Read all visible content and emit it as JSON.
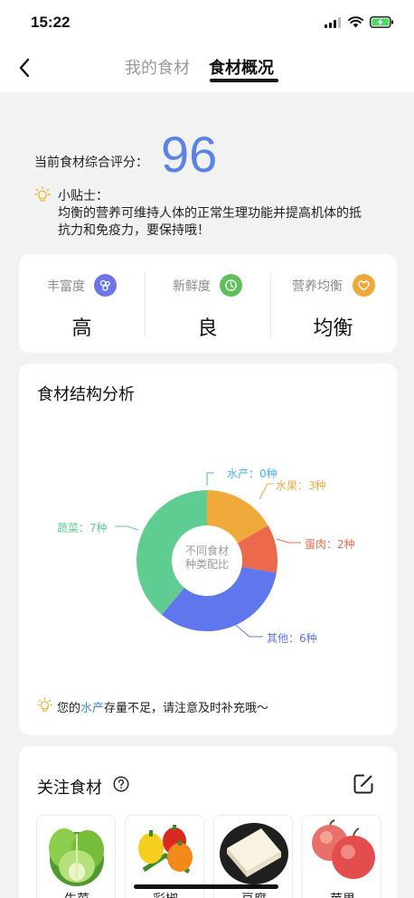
{
  "status_bar": {
    "time": "15:22"
  },
  "nav": {
    "tabs": [
      {
        "label": "我的食材",
        "active": false
      },
      {
        "label": "食材概况",
        "active": true
      }
    ]
  },
  "score": {
    "label": "当前食材综合评分：",
    "value": "96",
    "tip_title": "小贴士：",
    "tip_text": "均衡的营养可维持人体的正常生理功能并提高机体的抵抗力和免疫力，要保持哦！"
  },
  "metrics": [
    {
      "label": "丰富度",
      "value": "高",
      "icon": "richness-icon",
      "color": "#6e75e6"
    },
    {
      "label": "新鲜度",
      "value": "良",
      "icon": "clock-icon",
      "color": "#5cc15b"
    },
    {
      "label": "营养均衡",
      "value": "均衡",
      "icon": "balance-icon",
      "color": "#f2a93b"
    }
  ],
  "analysis": {
    "title": "食材结构分析",
    "center_line1": "不同食材",
    "center_line2": "种类配比",
    "labels": {
      "aquatic": "水产：0种",
      "fruit": "水果：3种",
      "meat": "蛋肉：2种",
      "other": "其他：6种",
      "veg": "蔬菜：7种"
    },
    "notice_prefix": "您的",
    "notice_highlight": "水产",
    "notice_suffix": "存量不足，请注意及时补充哦～"
  },
  "chart_data": {
    "type": "pie",
    "title": "",
    "donut": true,
    "series": [
      {
        "name": "水产",
        "value": 0,
        "color": "#45b4e0"
      },
      {
        "name": "水果",
        "value": 3,
        "color": "#f0a93b"
      },
      {
        "name": "蛋肉",
        "value": 2,
        "color": "#ec6a4b"
      },
      {
        "name": "其他",
        "value": 6,
        "color": "#6076ec"
      },
      {
        "name": "蔬菜",
        "value": 7,
        "color": "#5fcd92"
      }
    ]
  },
  "follow": {
    "title": "关注食材",
    "items": [
      {
        "name": "生菜",
        "image": "lettuce"
      },
      {
        "name": "彩椒",
        "image": "bell-peppers"
      },
      {
        "name": "豆腐",
        "image": "tofu"
      },
      {
        "name": "苹果",
        "image": "apples"
      }
    ]
  }
}
